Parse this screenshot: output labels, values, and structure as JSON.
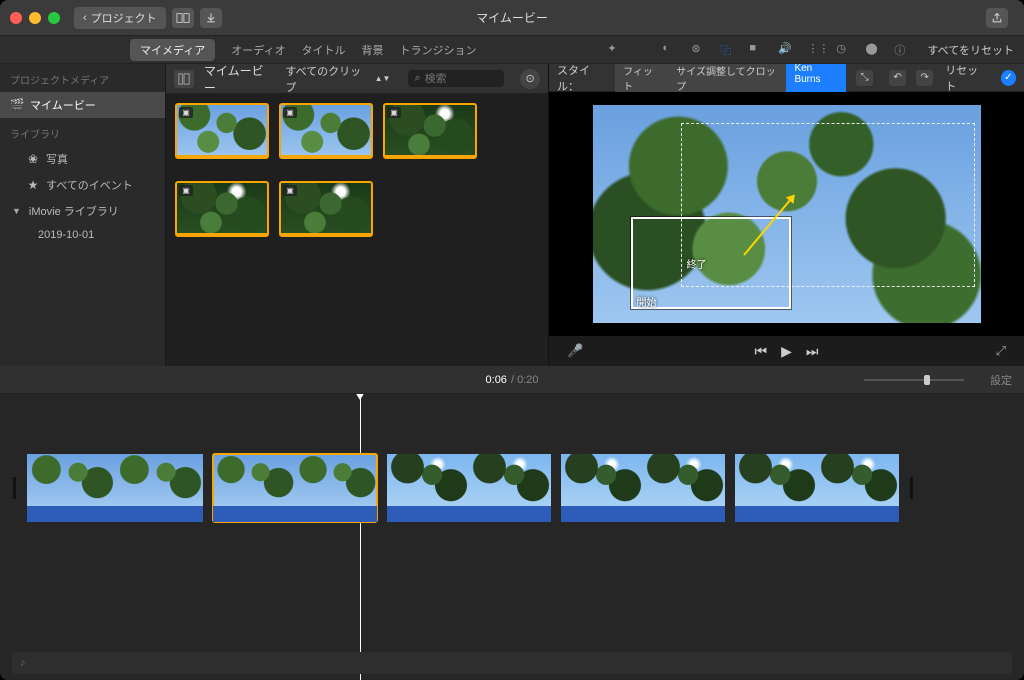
{
  "titlebar": {
    "back_label": "プロジェクト",
    "title": "マイムービー"
  },
  "tabs": {
    "my_media": "マイメディア",
    "audio": "オーディオ",
    "titles": "タイトル",
    "backgrounds": "背景",
    "transitions": "トランジション",
    "reset_all": "すべてをリセット"
  },
  "sidebar": {
    "project_media": "プロジェクトメディア",
    "my_movie": "マイムービー",
    "library_heading": "ライブラリ",
    "photos": "写真",
    "all_events": "すべてのイベント",
    "imovie_lib": "iMovie ライブラリ",
    "event_date": "2019-10-01"
  },
  "browser_header": {
    "crumb": "マイムービー",
    "filter": "すべてのクリップ",
    "search_placeholder": "検索"
  },
  "viewer": {
    "style_label": "スタイル：",
    "fit": "フィット",
    "crop": "サイズ調整してクロップ",
    "kenburns": "Ken Burns",
    "reset": "リセット",
    "kb_start": "開始",
    "kb_end": "終了"
  },
  "timeline": {
    "current": "0:06",
    "total": "0:20",
    "settings": "設定"
  }
}
